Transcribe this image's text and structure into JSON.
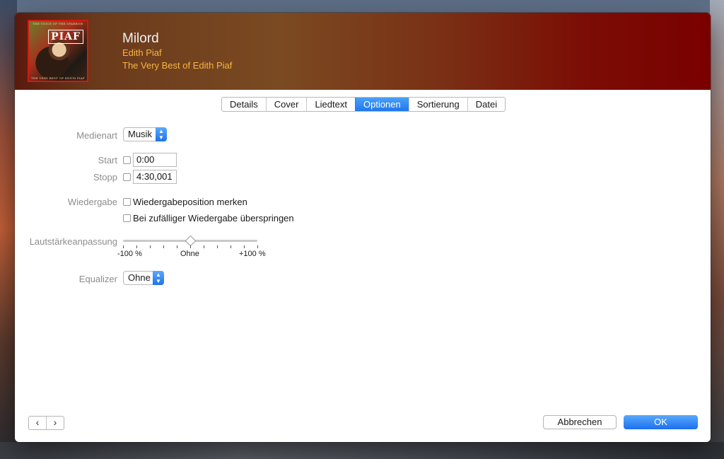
{
  "header": {
    "title": "Milord",
    "artist": "Edith Piaf",
    "album": "The Very Best of Edith Piaf",
    "artwork": {
      "top_text": "THE VOICE OF THE SPARROW",
      "piaf_text": "PIAF",
      "bottom_text": "THE VERY BEST OF EDITH PIAF"
    }
  },
  "tabs": [
    {
      "label": "Details",
      "active": false
    },
    {
      "label": "Cover",
      "active": false
    },
    {
      "label": "Liedtext",
      "active": false
    },
    {
      "label": "Optionen",
      "active": true
    },
    {
      "label": "Sortierung",
      "active": false
    },
    {
      "label": "Datei",
      "active": false
    }
  ],
  "options": {
    "media_kind_label": "Medienart",
    "media_kind_value": "Musik",
    "start_label": "Start",
    "start_checked": false,
    "start_value": "0:00",
    "stop_label": "Stopp",
    "stop_checked": false,
    "stop_value": "4:30,001",
    "playback_label": "Wiedergabe",
    "remember_position_label": "Wiedergabeposition merken",
    "remember_position_checked": false,
    "skip_shuffle_label": "Bei zufälliger Wiedergabe überspringen",
    "skip_shuffle_checked": false,
    "volume_label": "Lautstärkeanpassung",
    "volume_value_percent": 0,
    "volume_min_label": "-100 %",
    "volume_mid_label": "Ohne",
    "volume_max_label": "+100 %",
    "equalizer_label": "Equalizer",
    "equalizer_value": "Ohne"
  },
  "footer": {
    "prev_icon": "chevron-left-icon",
    "next_icon": "chevron-right-icon",
    "cancel_label": "Abbrechen",
    "ok_label": "OK"
  },
  "colors": {
    "accent": "#1f78ee",
    "header_text_secondary": "#f6b640"
  }
}
